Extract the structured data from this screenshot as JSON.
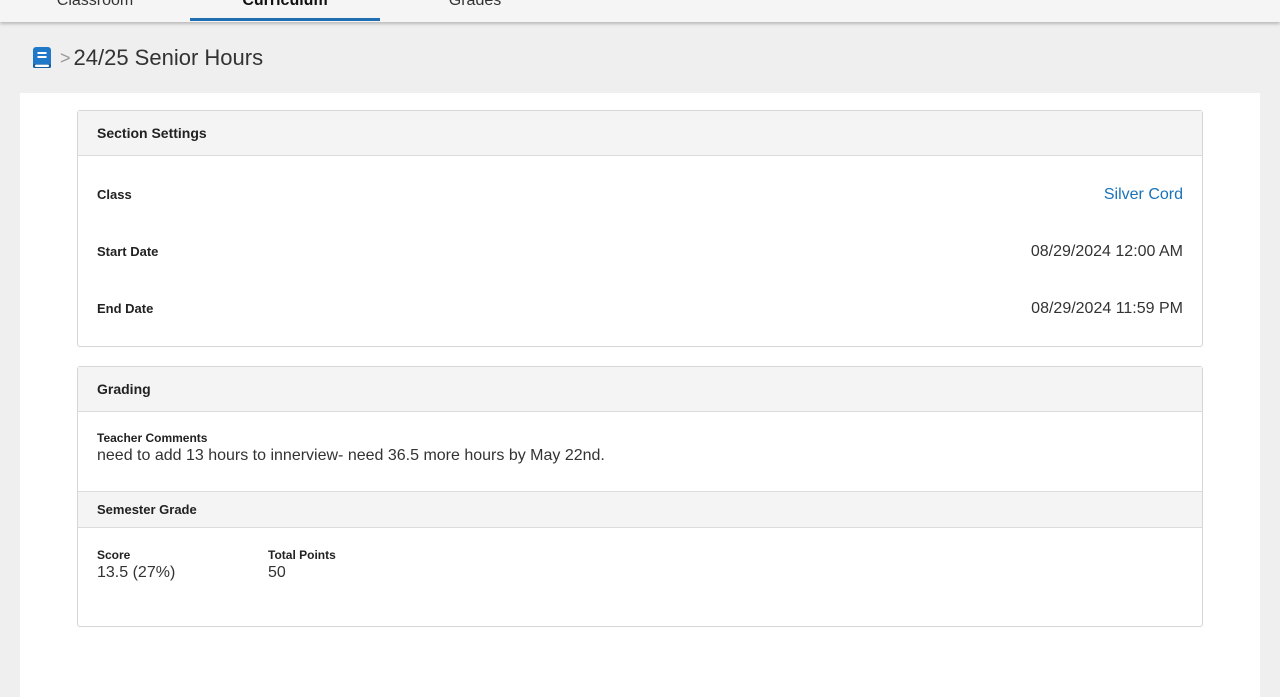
{
  "tabs": [
    {
      "label": "Classroom",
      "active": false
    },
    {
      "label": "Curriculum",
      "active": true
    },
    {
      "label": "Grades",
      "active": false
    }
  ],
  "breadcrumb": {
    "icon": "book-icon",
    "separator": ">",
    "title": "24/25 Senior Hours"
  },
  "section_settings": {
    "title": "Section Settings",
    "rows": [
      {
        "label": "Class",
        "value": "Silver Cord",
        "is_link": true
      },
      {
        "label": "Start Date",
        "value": "08/29/2024 12:00 AM",
        "is_link": false
      },
      {
        "label": "End Date",
        "value": "08/29/2024 11:59 PM",
        "is_link": false
      }
    ]
  },
  "grading": {
    "title": "Grading",
    "teacher_comments_label": "Teacher Comments",
    "teacher_comments": "need to add 13 hours to innerview- need 36.5 more hours by May 22nd.",
    "semester_grade_title": "Semester Grade",
    "score_label": "Score",
    "score_value": "13.5 (27%)",
    "total_points_label": "Total Points",
    "total_points_value": "50"
  },
  "colors": {
    "accent": "#1f6fb2",
    "link": "#1a73b8",
    "icon": "#1f78c8"
  }
}
